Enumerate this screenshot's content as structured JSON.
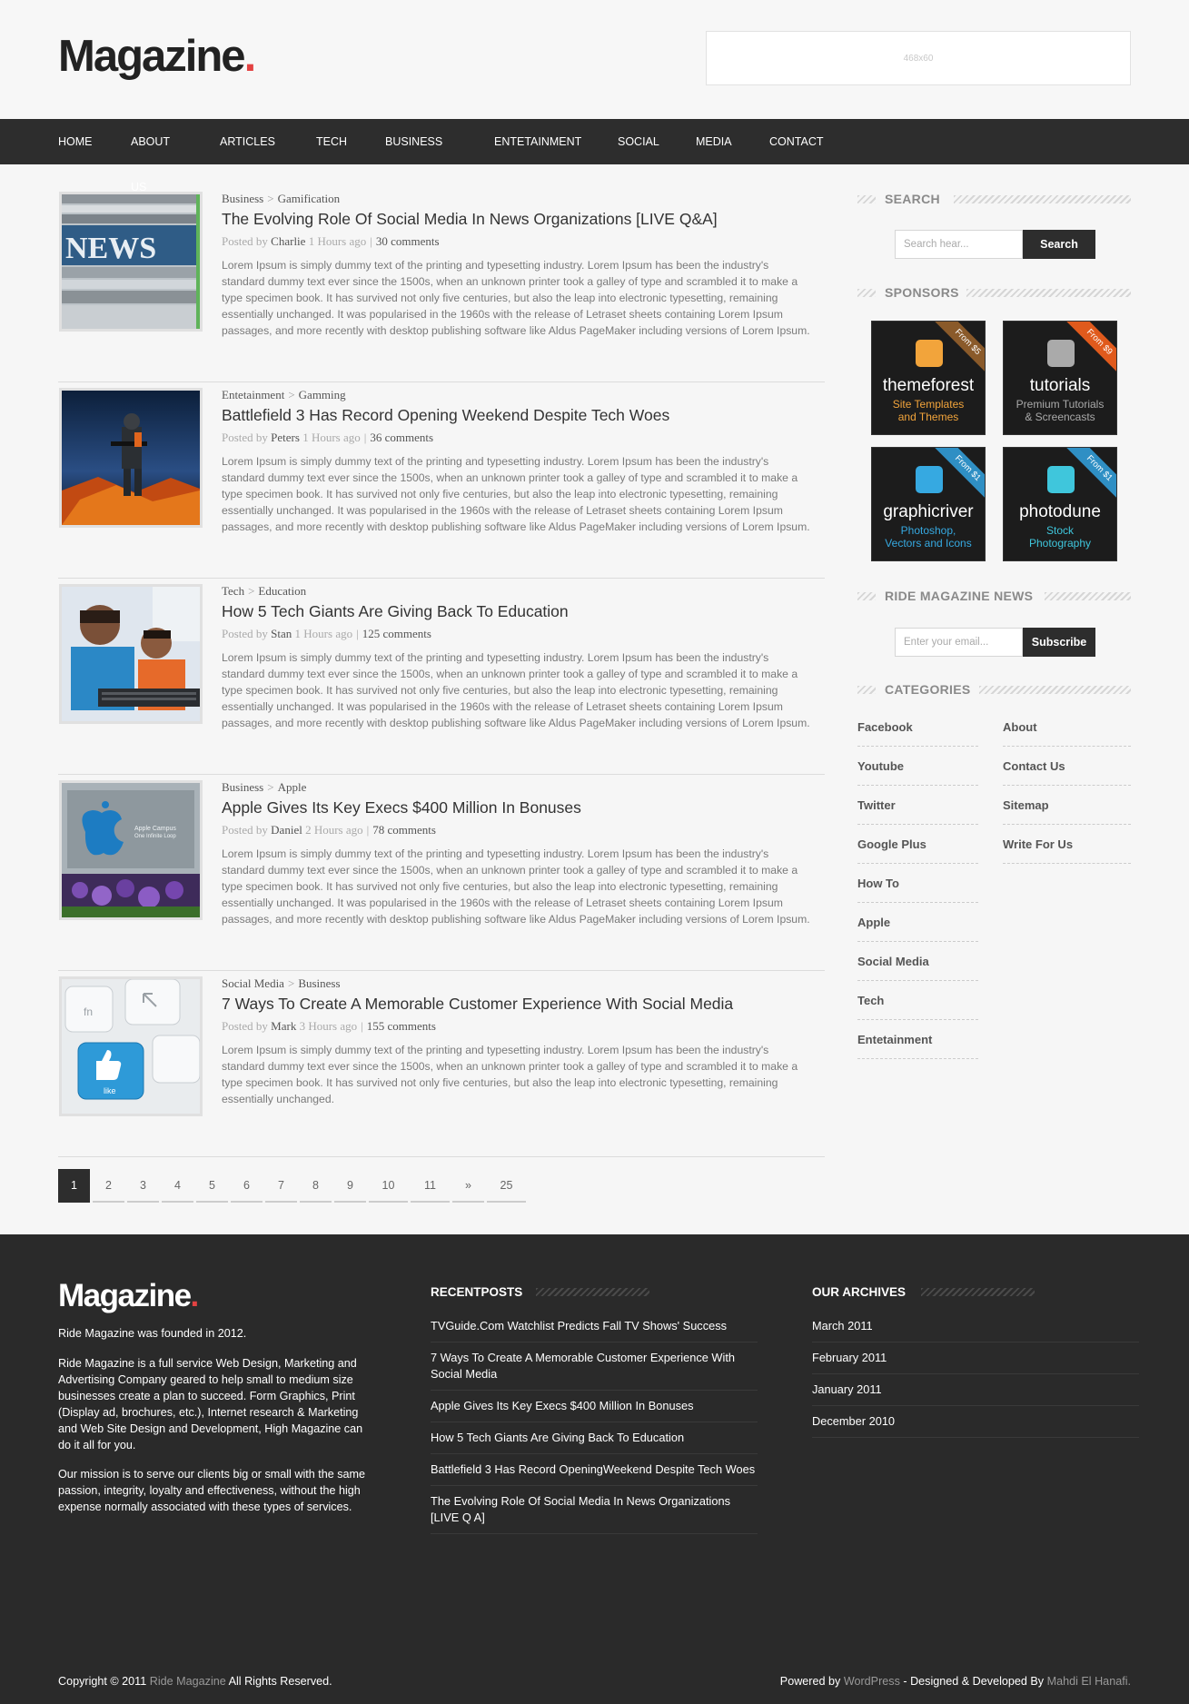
{
  "header": {
    "logo": "Magazine",
    "logo_dot": ".",
    "ad_text": "468x60"
  },
  "nav": [
    "HOME",
    "ABOUT US",
    "ARTICLES",
    "TECH",
    "BUSINESS",
    "ENTETAINMENT",
    "SOCIAL",
    "MEDIA",
    "CONTACT"
  ],
  "posts": [
    {
      "cat1": "Business",
      "cat2": "Gamification",
      "title": "The Evolving Role Of Social Media In News Organizations [LIVE Q&A]",
      "by": "Posted by",
      "author": "Charlie",
      "ago": "1 Hours ago",
      "comments": "30 comments",
      "thumb": "news-thumbnail",
      "excerpt": "Lorem Ipsum is simply dummy text of the printing and typesetting industry. Lorem Ipsum has been the industry's standard dummy text ever since the 1500s, when an unknown printer took a galley of type and scrambled it to make a type specimen book. It has survived not only five centuries, but also the leap into electronic typesetting, remaining essentially unchanged. It was popularised in the 1960s with the release of Letraset sheets containing Lorem Ipsum passages, and more recently with desktop publishing software like Aldus PageMaker including versions of Lorem Ipsum."
    },
    {
      "cat1": "Entetainment",
      "cat2": "Gamming",
      "title": "Battlefield 3 Has Record Opening Weekend Despite Tech Woes",
      "by": "Posted by",
      "author": "Peters",
      "ago": "1 Hours ago",
      "comments": "36 comments",
      "thumb": "battlefield-thumbnail",
      "excerpt": "Lorem Ipsum is simply dummy text of the printing and typesetting industry. Lorem Ipsum has been the industry's standard dummy text ever since the 1500s, when an unknown printer took a galley of type and scrambled it to make a type specimen book. It has survived not only five centuries, but also the leap into electronic typesetting, remaining essentially unchanged. It was popularised in the 1960s with the release of Letraset sheets containing Lorem Ipsum passages, and more recently with desktop publishing software like Aldus PageMaker including versions of Lorem Ipsum."
    },
    {
      "cat1": "Tech",
      "cat2": "Education",
      "title": "How 5 Tech Giants Are Giving Back To Education",
      "by": "Posted by",
      "author": "Stan",
      "ago": "1 Hours ago",
      "comments": "125 comments",
      "thumb": "kids-computer-thumbnail",
      "excerpt": "Lorem Ipsum is simply dummy text of the printing and typesetting industry. Lorem Ipsum has been the industry's standard dummy text ever since the 1500s, when an unknown printer took a galley of type and scrambled it to make a type specimen book. It has survived not only five centuries, but also the leap into electronic typesetting, remaining essentially unchanged. It was popularised in the 1960s with the release of Letraset sheets containing Lorem Ipsum passages, and more recently with desktop publishing software like Aldus PageMaker including versions of Lorem Ipsum."
    },
    {
      "cat1": "Business",
      "cat2": "Apple",
      "title": "Apple Gives Its Key Execs $400 Million In Bonuses",
      "by": "Posted by",
      "author": "Daniel",
      "ago": "2 Hours ago",
      "comments": "78 comments",
      "thumb": "apple-campus-thumbnail",
      "excerpt": "Lorem Ipsum is simply dummy text of the printing and typesetting industry. Lorem Ipsum has been the industry's standard dummy text ever since the 1500s, when an unknown printer took a galley of type and scrambled it to make a type specimen book. It has survived not only five centuries, but also the leap into electronic typesetting, remaining essentially unchanged. It was popularised in the 1960s with the release of Letraset sheets containing Lorem Ipsum passages, and more recently with desktop publishing software like Aldus PageMaker including versions of Lorem Ipsum."
    },
    {
      "cat1": "Social Media",
      "cat2": "Business",
      "title": "7 Ways To Create A Memorable Customer Experience With Social Media",
      "by": "Posted by",
      "author": "Mark",
      "ago": "3 Hours ago",
      "comments": "155 comments",
      "thumb": "like-key-thumbnail",
      "excerpt": "Lorem Ipsum is simply dummy text of the printing and typesetting industry. Lorem Ipsum has been the industry's standard dummy text ever since the 1500s, when an unknown printer took a galley of type and scrambled it to make a type specimen book. It has survived not only five centuries, but also the leap into electronic typesetting, remaining essentially unchanged."
    }
  ],
  "pagination": [
    "1",
    "2",
    "3",
    "4",
    "5",
    "6",
    "7",
    "8",
    "9",
    "10",
    "11",
    "»",
    "25"
  ],
  "sidebar": {
    "search_title": "SEARCH",
    "search_placeholder": "Search hear...",
    "search_button": "Search",
    "sponsors_title": "SPONSORS",
    "sponsors": [
      {
        "name": "themeforest",
        "sub1": "Site Templates",
        "sub2": "and Themes",
        "price": "From $5",
        "color": "#f2a43b",
        "ribbon": "#8a5a2a"
      },
      {
        "name": "tutorials",
        "sub1": "Premium Tutorials",
        "sub2": "& Screencasts",
        "price": "From $9",
        "color": "#aaaaaa",
        "ribbon": "#e05a1c"
      },
      {
        "name": "graphicriver",
        "sub1": "Photoshop,",
        "sub2": "Vectors and Icons",
        "price": "From $1",
        "color": "#36a9e1",
        "ribbon": "#2f8fc4"
      },
      {
        "name": "photodune",
        "sub1": "Stock",
        "sub2": "Photography",
        "price": "From $1",
        "color": "#3fc6dc",
        "ribbon": "#2f8fc4"
      }
    ],
    "news_title": "RIDE MAGAZINE NEWS",
    "email_placeholder": "Enter your email...",
    "subscribe_button": "Subscribe",
    "categories_title": "CATEGORIES",
    "categories_left": [
      "Facebook",
      "Youtube",
      "Twitter",
      "Google Plus",
      "How To",
      "Apple",
      "Social Media",
      "Tech",
      "Entetainment"
    ],
    "categories_right": [
      "About",
      "Contact Us",
      "Sitemap",
      "Write For Us"
    ]
  },
  "footer": {
    "logo": "Magazine",
    "logo_dot": ".",
    "founded": "Ride Magazine was founded in 2012.",
    "about": "Ride Magazine is a full service Web Design, Marketing and Advertising Company geared to help small to medium size businesses create a plan to succeed. Form Graphics, Print (Display ad, brochures, etc.), Internet research & Marketing and Web Site Design and Development, High Magazine can do it all for you.",
    "mission": "Our mission is to serve our clients big or small with the same passion, integrity, loyalty and effectiveness, without the high expense normally associated with these types of services.",
    "recent_title": "RECENTPOSTS",
    "recent": [
      "TVGuide.Com Watchlist Predicts Fall TV Shows' Success",
      "7 Ways To Create A Memorable Customer Experience With Social Media",
      "Apple Gives Its Key Execs $400 Million In Bonuses",
      "How 5 Tech Giants Are Giving Back To Education",
      "Battlefield 3 Has Record OpeningWeekend Despite Tech Woes",
      "The Evolving Role Of Social Media In News Organizations [LIVE Q A]"
    ],
    "archives_title": "OUR ARCHIVES",
    "archives": [
      "March 2011",
      "February 2011",
      "January 2011",
      "December 2010"
    ],
    "copyright_pre": "Copyright © 2011",
    "copyright_site": "Ride Magazine",
    "copyright_post": "All Rights Reserved.",
    "powered_pre": "Powered by",
    "powered_wp": "WordPress",
    "powered_mid": "- Designed & Developed By",
    "powered_author": "Mahdi El Hanafi."
  }
}
